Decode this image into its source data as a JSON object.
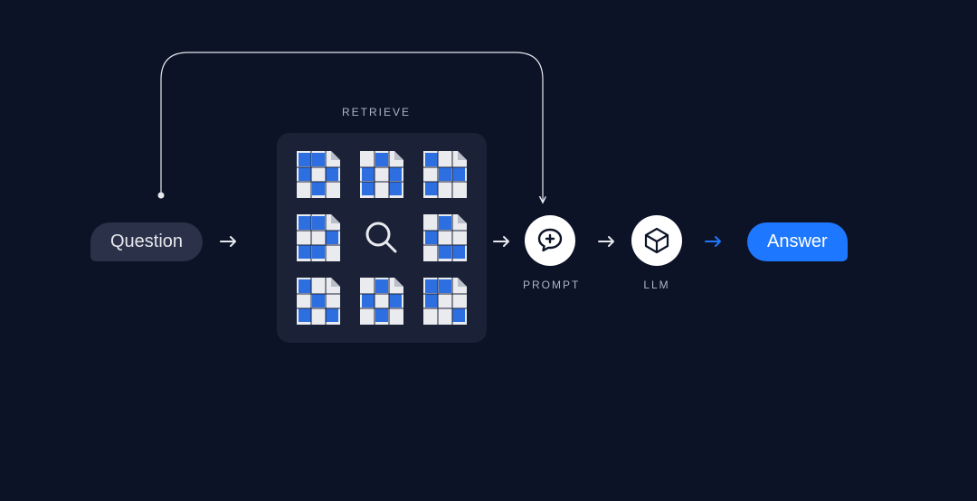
{
  "nodes": {
    "question": {
      "label": "Question"
    },
    "retrieve": {
      "label": "RETRIEVE"
    },
    "prompt": {
      "label": "PROMPT"
    },
    "llm": {
      "label": "LLM"
    },
    "answer": {
      "label": "Answer"
    }
  },
  "icons": {
    "search": "magnifying-glass-icon",
    "prompt": "chat-plus-icon",
    "llm": "cube-wireframe-icon"
  },
  "colors": {
    "bg": "#0d1327",
    "panel": "#1b2238",
    "bubble_q": "#2a3148",
    "bubble_a": "#1e78ff",
    "accent": "#1e78ff",
    "text": "#e6e8ee",
    "label": "#aeb4c7",
    "white": "#ffffff"
  },
  "flow": [
    {
      "from": "question",
      "to": "retrieve",
      "color": "white"
    },
    {
      "from": "retrieve",
      "to": "prompt",
      "color": "white"
    },
    {
      "from": "prompt",
      "to": "llm",
      "color": "white"
    },
    {
      "from": "llm",
      "to": "answer",
      "color": "blue"
    },
    {
      "from": "question",
      "to": "prompt",
      "color": "white",
      "style": "curved_over"
    }
  ],
  "retrieve_grid": {
    "rows": 3,
    "cols": 3,
    "center_cell": "search",
    "document_count": 8
  }
}
